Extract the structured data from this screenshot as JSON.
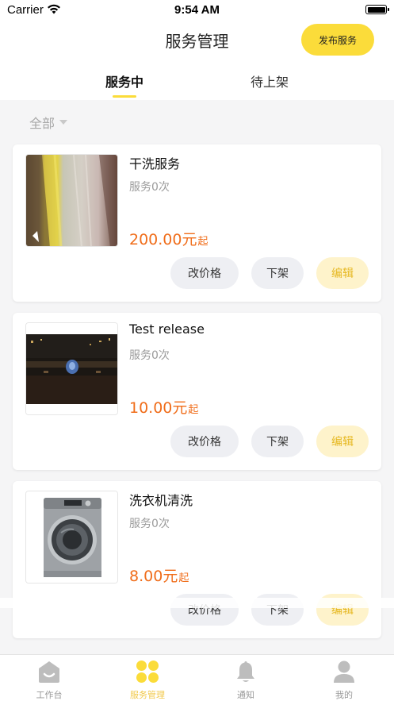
{
  "status_bar": {
    "carrier": "Carrier",
    "time": "9:54 AM"
  },
  "nav": {
    "title": "服务管理",
    "publish_label": "发布服务"
  },
  "tabs": [
    {
      "label": "服务中",
      "active": true
    },
    {
      "label": "待上架",
      "active": false
    }
  ],
  "filter": {
    "label": "全部"
  },
  "services": [
    {
      "title": "干洗服务",
      "count": "服务0次",
      "price": "200.00",
      "unit": "元",
      "suffix": "起",
      "image": "fabric-photo"
    },
    {
      "title": "Test release",
      "count": "服务0次",
      "price": "10.00",
      "unit": "元",
      "suffix": "起",
      "image": "night-fountain-photo"
    },
    {
      "title": "洗衣机清洗",
      "count": "服务0次",
      "price": "8.00",
      "unit": "元",
      "suffix": "起",
      "image": "washing-machine-photo"
    }
  ],
  "card_actions": {
    "change_price": "改价格",
    "take_down": "下架",
    "edit": "编辑"
  },
  "tabbar": [
    {
      "label": "工作台",
      "icon": "home-icon",
      "active": false
    },
    {
      "label": "服务管理",
      "icon": "clover-icon",
      "active": true
    },
    {
      "label": "通知",
      "icon": "bell-icon",
      "active": false
    },
    {
      "label": "我的",
      "icon": "person-icon",
      "active": false
    }
  ],
  "colors": {
    "accent": "#fbdc3a",
    "price": "#f06d1a",
    "edit_text": "#e6b821",
    "tab_active": "#f2c94c"
  }
}
